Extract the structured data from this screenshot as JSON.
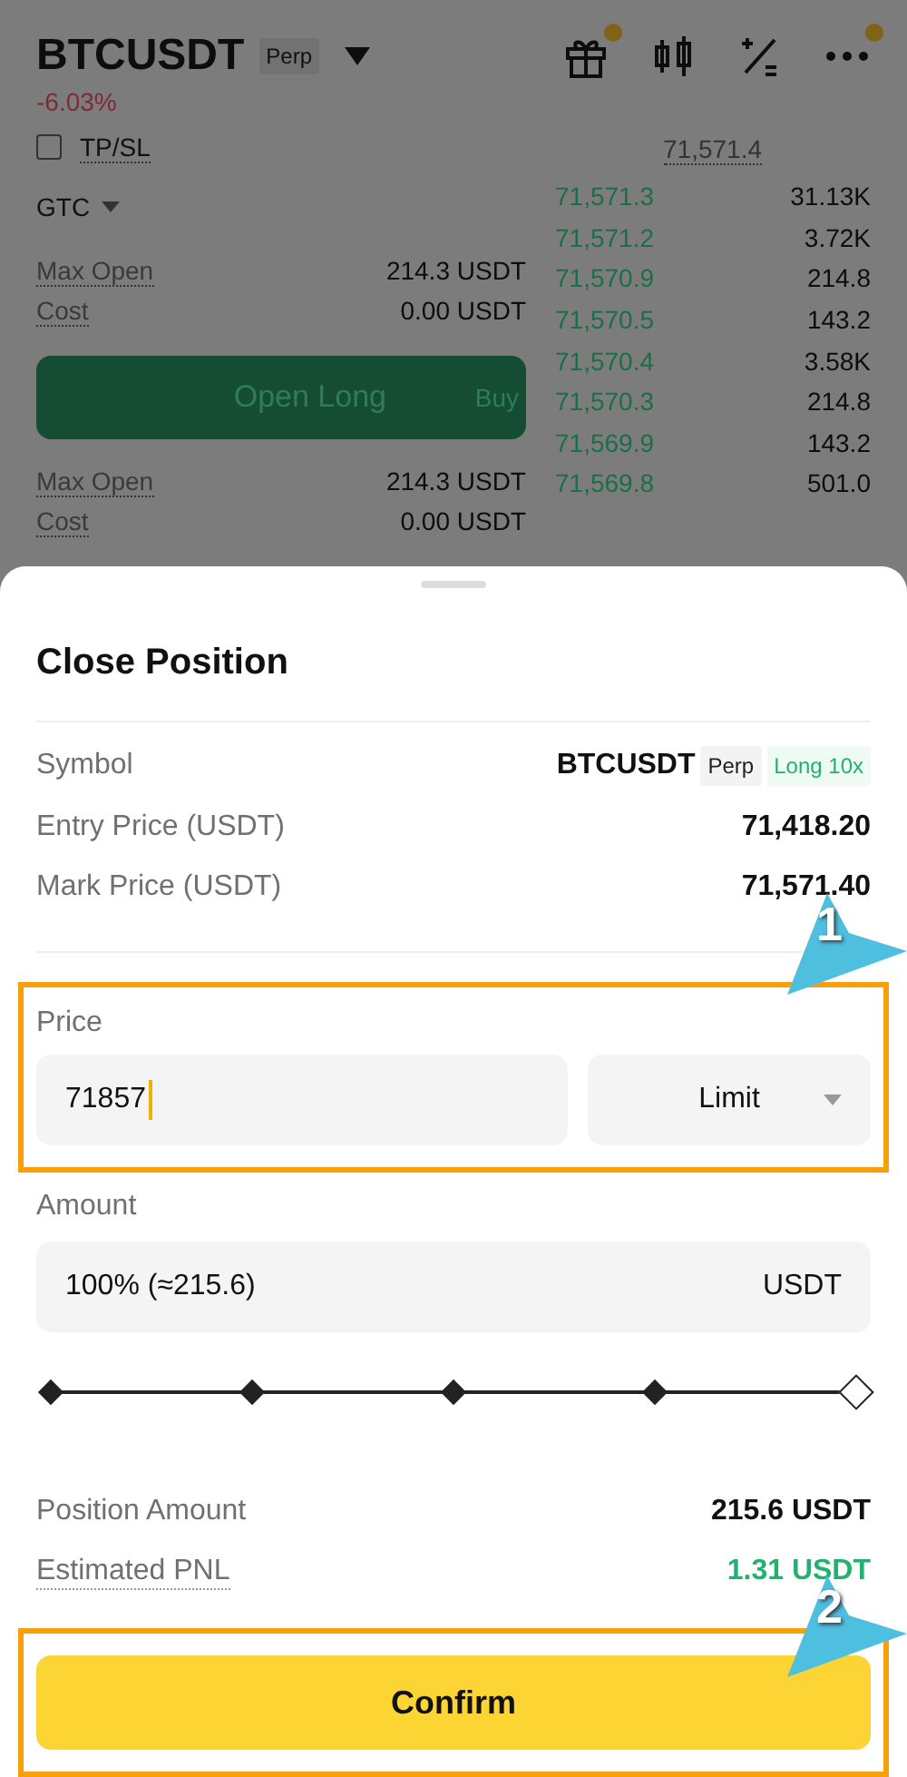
{
  "header": {
    "symbol": "BTCUSDT",
    "tag": "Perp",
    "change": "-6.03%",
    "toolbar": [
      {
        "kind": "gift",
        "dot": true
      },
      {
        "kind": "candles",
        "dot": false
      },
      {
        "kind": "calc",
        "dot": false
      },
      {
        "kind": "more",
        "dot": true
      }
    ]
  },
  "order_form": {
    "tpsl": {
      "label": "TP/SL",
      "checked": false
    },
    "time_in_force": "GTC",
    "rows_top": [
      {
        "label": "Max Open",
        "value": "214.3 USDT"
      },
      {
        "label": "Cost",
        "value": "0.00 USDT"
      }
    ],
    "button": {
      "label": "Open Long",
      "side": "Buy"
    },
    "rows_bottom": [
      {
        "label": "Max Open",
        "value": "214.3 USDT"
      },
      {
        "label": "Cost",
        "value": "0.00 USDT"
      }
    ]
  },
  "order_book": {
    "top_price": "71,571.4",
    "rows": [
      {
        "price": "71,571.3",
        "size": "31.13K"
      },
      {
        "price": "71,571.2",
        "size": "3.72K"
      },
      {
        "price": "71,570.9",
        "size": "214.8"
      },
      {
        "price": "71,570.5",
        "size": "143.2"
      },
      {
        "price": "71,570.4",
        "size": "3.58K"
      },
      {
        "price": "71,570.3",
        "size": "214.8"
      },
      {
        "price": "71,569.9",
        "size": "143.2"
      },
      {
        "price": "71,569.8",
        "size": "501.0"
      }
    ]
  },
  "sheet": {
    "title": "Close Position",
    "symbol": {
      "label": "Symbol",
      "value": "BTCUSDT",
      "tags": [
        {
          "kind": "plain",
          "text": "Perp"
        },
        {
          "kind": "long",
          "text": "Long 10x"
        }
      ]
    },
    "info": [
      {
        "label": "Entry Price (USDT)",
        "value": "71,418.20"
      },
      {
        "label": "Mark Price (USDT)",
        "value": "71,571.40"
      }
    ],
    "price": {
      "label": "Price",
      "value": "71857",
      "order_type": "Limit"
    },
    "amount": {
      "label": "Amount",
      "value": "100% (≈215.6)",
      "unit": "USDT",
      "level": 1
    },
    "summary": [
      {
        "label": "Position Amount",
        "value": "215.6 USDT",
        "kind": "neutral"
      },
      {
        "label": "Estimated PNL",
        "value": "1.31 USDT",
        "kind": "positive"
      }
    ],
    "confirm": "Confirm"
  },
  "annotations": [
    {
      "number": "1"
    },
    {
      "number": "2"
    }
  ]
}
